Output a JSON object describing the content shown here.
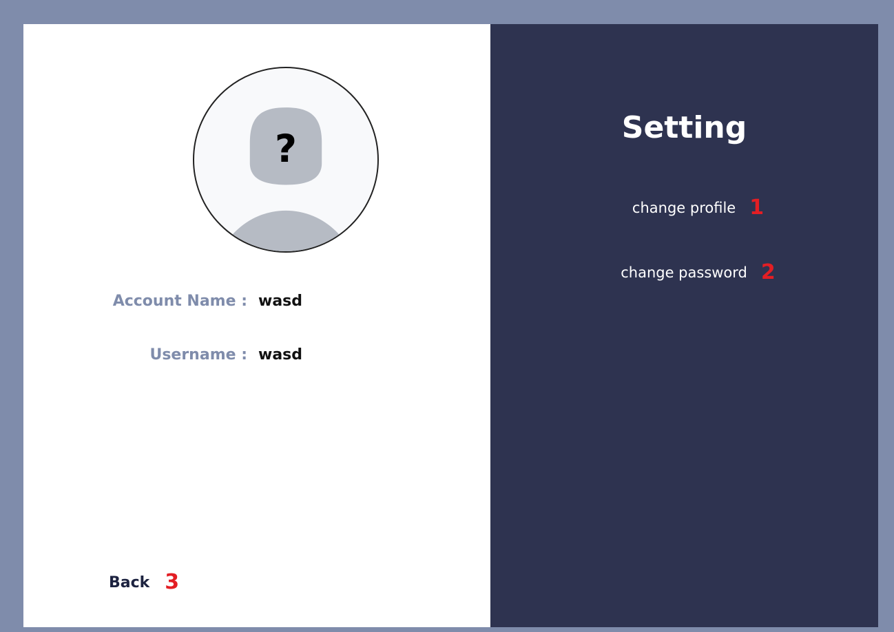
{
  "profile": {
    "avatar_icon": "unknown-user-icon",
    "avatar_glyph": "?",
    "account_name_label": "Account Name :",
    "account_name_value": "wasd",
    "username_label": "Username :",
    "username_value": "wasd"
  },
  "nav": {
    "back_label": "Back",
    "back_marker": "3"
  },
  "settings": {
    "title": "Setting",
    "items": [
      {
        "label": "change profile",
        "marker": "1"
      },
      {
        "label": "change password",
        "marker": "2"
      }
    ]
  },
  "colors": {
    "page_background": "#7f8cab",
    "panel_dark": "#2e3350",
    "panel_light": "#ffffff",
    "label_color": "#7f8cab",
    "marker_red": "#e31e24"
  }
}
